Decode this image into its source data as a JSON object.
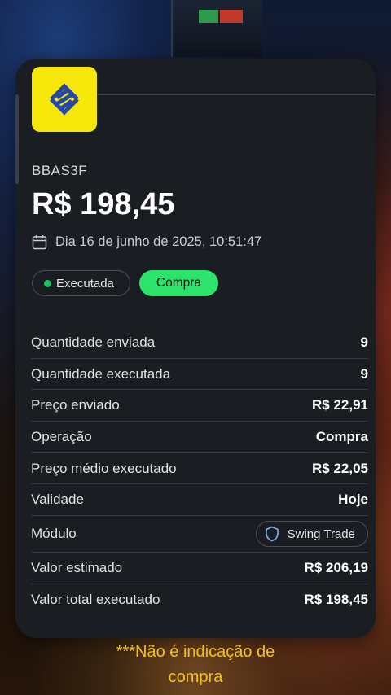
{
  "asset": {
    "logo": "banco-do-brasil-logo",
    "ticker": "BBAS3F",
    "price": "R$ 198,45",
    "datetime": "Dia 16 de junho de 2025, 10:51:47"
  },
  "chips": {
    "status": "Executada",
    "operation": "Compra"
  },
  "details": [
    {
      "label": "Quantidade enviada",
      "value": "9"
    },
    {
      "label": "Quantidade executada",
      "value": "9"
    },
    {
      "label": "Preço enviado",
      "value": "R$ 22,91"
    },
    {
      "label": "Operação",
      "value": "Compra"
    },
    {
      "label": "Preço médio executado",
      "value": "R$ 22,05"
    },
    {
      "label": "Validade",
      "value": "Hoje"
    },
    {
      "label": "Módulo",
      "value": "Swing Trade"
    },
    {
      "label": "Valor estimado",
      "value": "R$ 206,19"
    },
    {
      "label": "Valor total executado",
      "value": "R$ 198,45"
    }
  ],
  "disclaimer": {
    "line1": "***Não é indicação de",
    "line2": "compra"
  },
  "colors": {
    "card_bg": "#1a1d22",
    "logo_bg": "#f6e70a",
    "logo_mark": "#2548a8",
    "status_dot": "#19c25a",
    "buy_chip": "#2ce36b",
    "disclaimer": "#f3c21a"
  },
  "icons": {
    "date": "calendar-icon",
    "module": "shield-icon"
  }
}
